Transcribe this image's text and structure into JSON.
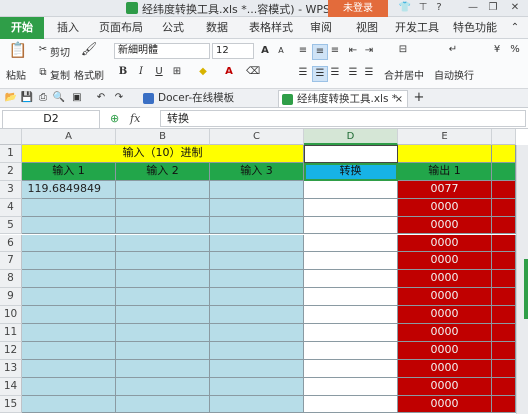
{
  "window": {
    "title": "经纬度转换工具.xls *...容模式) - WPS 表格",
    "login_button": "未登录",
    "controls": {
      "minimize": "—",
      "restore": "❐",
      "close": "✕"
    }
  },
  "ribbon_tabs": [
    {
      "label": "开始",
      "active": true
    },
    {
      "label": "插入"
    },
    {
      "label": "页面布局"
    },
    {
      "label": "公式"
    },
    {
      "label": "数据"
    },
    {
      "label": "表格样式"
    },
    {
      "label": "审阅"
    },
    {
      "label": "视图"
    },
    {
      "label": "开发工具"
    },
    {
      "label": "特色功能"
    }
  ],
  "ribbon": {
    "paste": "粘贴",
    "cut": "剪切",
    "copy": "复制",
    "format_painter": "格式刷",
    "font_name": "新細明體",
    "font_size": "12",
    "merge_center": "合并居中",
    "auto_wrap": "自动换行"
  },
  "doc_tabs": [
    {
      "label": "Docer-在线模板",
      "active": false
    },
    {
      "label": "经纬度转换工具.xls *",
      "active": true
    }
  ],
  "formula_bar": {
    "name_box": "D2",
    "fx": "fx",
    "formula": "转换"
  },
  "sheet": {
    "columns": [
      "A",
      "B",
      "C",
      "D",
      "E"
    ],
    "active_column": "D",
    "rows": [
      "1",
      "2",
      "3",
      "4",
      "5",
      "6",
      "7",
      "8",
      "9",
      "10",
      "11",
      "12",
      "13",
      "14",
      "15"
    ],
    "row1_title": "输入（10）进制",
    "headers": {
      "input1": "输入 1",
      "input2": "输入 2",
      "input3": "输入 3",
      "convert": "转换",
      "output1": "输出 1"
    },
    "a3_value": "119.6849849",
    "output_values": [
      "0077",
      "0000",
      "0000",
      "0000",
      "0000",
      "0000",
      "0000",
      "0000",
      "0000",
      "0000",
      "0000",
      "0000",
      "0000"
    ]
  }
}
